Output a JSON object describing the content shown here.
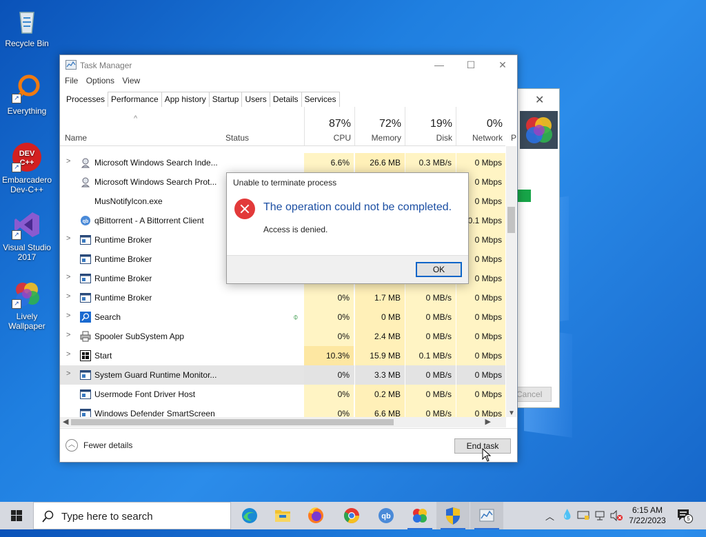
{
  "desktop": {
    "icons": [
      {
        "label": "Recycle Bin"
      },
      {
        "label": "Everything"
      },
      {
        "label": "Embarcadero Dev-C++"
      },
      {
        "label": "Visual Studio 2017"
      },
      {
        "label": "Lively Wallpaper"
      }
    ]
  },
  "background_window": {
    "cancel_label": "Cancel"
  },
  "task_manager": {
    "title": "Task Manager",
    "menu": [
      "File",
      "Options",
      "View"
    ],
    "tabs": [
      "Processes",
      "Performance",
      "App history",
      "Startup",
      "Users",
      "Details",
      "Services"
    ],
    "active_tab": "Processes",
    "columns": {
      "name": "Name",
      "status": "Status",
      "cpu": {
        "pct": "87%",
        "label": "CPU"
      },
      "memory": {
        "pct": "72%",
        "label": "Memory"
      },
      "disk": {
        "pct": "19%",
        "label": "Disk"
      },
      "network": {
        "pct": "0%",
        "label": "Network"
      },
      "power": "P"
    },
    "rows": [
      {
        "name": "Microsoft Windows Search Inde...",
        "expand": true,
        "icon": "search-service-icon",
        "cpu": "6.6%",
        "mem": "26.6 MB",
        "disk": "0.3 MB/s",
        "net": "0 Mbps"
      },
      {
        "name": "Microsoft Windows Search Prot...",
        "expand": false,
        "icon": "search-service-icon",
        "cpu": "",
        "mem": "",
        "disk": "",
        "net": "0 Mbps"
      },
      {
        "name": "MusNotifyIcon.exe",
        "expand": false,
        "icon": "",
        "cpu": "",
        "mem": "",
        "disk": "",
        "net": "0 Mbps"
      },
      {
        "name": "qBittorrent - A Bittorrent Client",
        "expand": false,
        "icon": "qbittorrent-icon",
        "cpu": "",
        "mem": "",
        "disk": "",
        "net": "0.1 Mbps"
      },
      {
        "name": "Runtime Broker",
        "expand": true,
        "icon": "app-window-icon",
        "cpu": "",
        "mem": "",
        "disk": "",
        "net": "0 Mbps"
      },
      {
        "name": "Runtime Broker",
        "expand": false,
        "icon": "app-window-icon",
        "cpu": "",
        "mem": "",
        "disk": "",
        "net": "0 Mbps"
      },
      {
        "name": "Runtime Broker",
        "expand": true,
        "icon": "app-window-icon",
        "cpu": "",
        "mem": "",
        "disk": "",
        "net": "0 Mbps"
      },
      {
        "name": "Runtime Broker",
        "expand": true,
        "icon": "app-window-icon",
        "cpu": "0%",
        "mem": "1.7 MB",
        "disk": "0 MB/s",
        "net": "0 Mbps"
      },
      {
        "name": "Search",
        "expand": true,
        "icon": "search-app-icon",
        "cpu": "0%",
        "mem": "0 MB",
        "disk": "0 MB/s",
        "net": "0 Mbps"
      },
      {
        "name": "Spooler SubSystem App",
        "expand": true,
        "icon": "printer-icon",
        "cpu": "0%",
        "mem": "2.4 MB",
        "disk": "0 MB/s",
        "net": "0 Mbps"
      },
      {
        "name": "Start",
        "expand": true,
        "icon": "start-app-icon",
        "cpu": "10.3%",
        "mem": "15.9 MB",
        "disk": "0.1 MB/s",
        "net": "0 Mbps"
      },
      {
        "name": "System Guard Runtime Monitor...",
        "expand": true,
        "icon": "app-window-icon",
        "cpu": "0%",
        "mem": "3.3 MB",
        "disk": "0 MB/s",
        "net": "0 Mbps"
      },
      {
        "name": "Usermode Font Driver Host",
        "expand": false,
        "icon": "app-window-icon",
        "cpu": "0%",
        "mem": "0.2 MB",
        "disk": "0 MB/s",
        "net": "0 Mbps"
      },
      {
        "name": "Windows Defender SmartScreen",
        "expand": false,
        "icon": "app-window-icon",
        "cpu": "0%",
        "mem": "6.6 MB",
        "disk": "0 MB/s",
        "net": "0 Mbps"
      }
    ],
    "fewer_details": "Fewer details",
    "end_task": "End task"
  },
  "dialog": {
    "title": "Unable to terminate process",
    "main": "The operation could not be completed.",
    "sub": "Access is denied.",
    "ok": "OK"
  },
  "taskbar": {
    "search_placeholder": "Type here to search",
    "time": "6:15 AM",
    "date": "7/22/2023",
    "notification_count": "5"
  }
}
